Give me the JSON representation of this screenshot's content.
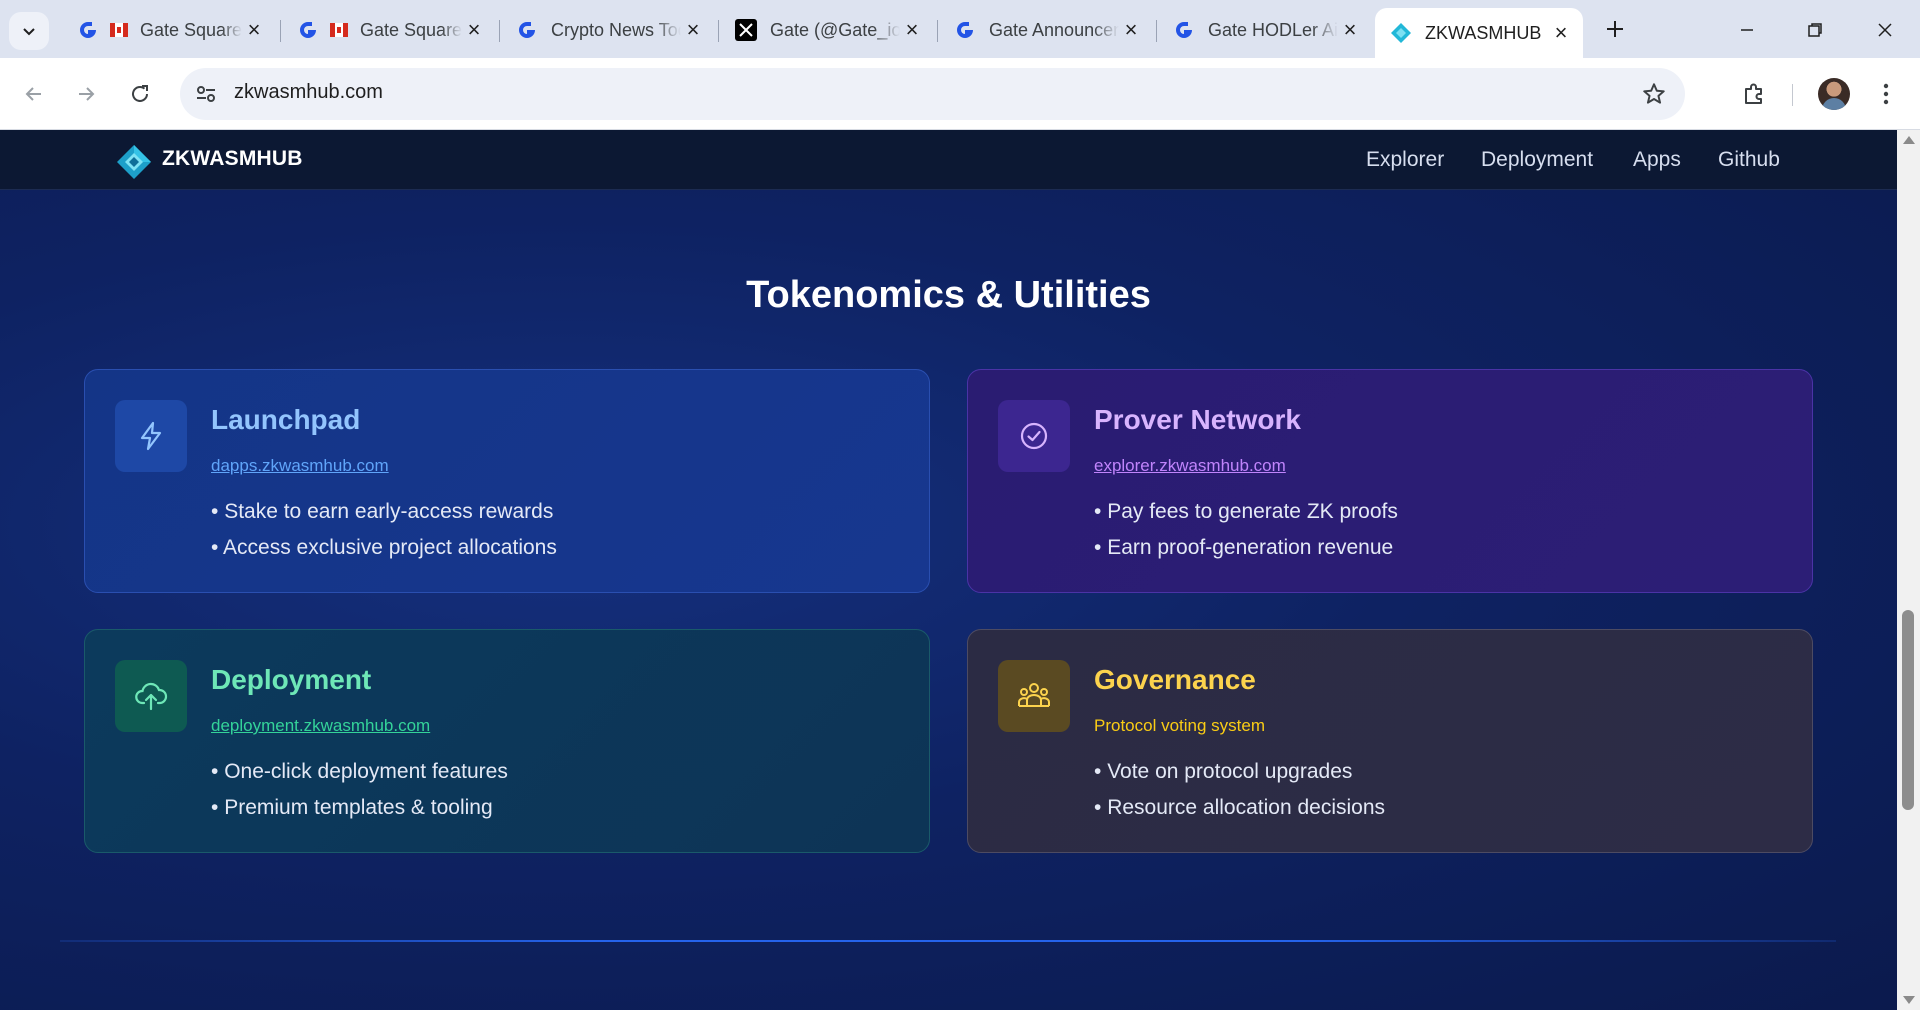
{
  "browser": {
    "tabs": [
      {
        "title": "Gate Square",
        "favicon": "gate-icon",
        "flag": true
      },
      {
        "title": "Gate Square",
        "favicon": "gate-icon",
        "flag": true
      },
      {
        "title": "Crypto News Today",
        "favicon": "gate-icon",
        "flag": false
      },
      {
        "title": "Gate (@Gate_io)",
        "favicon": "x-icon",
        "flag": false
      },
      {
        "title": "Gate Announcements",
        "favicon": "gate-icon",
        "flag": false
      },
      {
        "title": "Gate HODLer Airdrop",
        "favicon": "gate-icon",
        "flag": false
      }
    ],
    "active_tab": {
      "title": "ZKWASMHUB",
      "favicon": "zkwasmhub-logo-icon"
    },
    "url": "zkwasmhub.com"
  },
  "site": {
    "brand": "ZKWASMHUB",
    "nav": {
      "explorer": "Explorer",
      "deployment": "Deployment",
      "apps": "Apps",
      "github": "Github"
    },
    "section_title": "Tokenomics & Utilities",
    "cards": {
      "launchpad": {
        "title": "Launchpad",
        "link": "dapps.zkwasmhub.com",
        "icon": "lightning-icon",
        "bullets": [
          "Stake to earn early-access rewards",
          "Access exclusive project allocations"
        ]
      },
      "prover": {
        "title": "Prover Network",
        "link": "explorer.zkwasmhub.com",
        "icon": "check-circle-icon",
        "bullets": [
          "Pay fees to generate ZK proofs",
          "Earn proof-generation revenue"
        ]
      },
      "deployment": {
        "title": "Deployment",
        "link": "deployment.zkwasmhub.com",
        "icon": "cloud-upload-icon",
        "bullets": [
          "One-click deployment features",
          "Premium templates & tooling"
        ]
      },
      "governance": {
        "title": "Governance",
        "subtitle": "Protocol voting system",
        "icon": "people-group-icon",
        "bullets": [
          "Vote on protocol upgrades",
          "Resource allocation decisions"
        ]
      }
    }
  },
  "colors": {
    "page_bg": "#0e2262",
    "nav_bg": "#0c1833",
    "launchpad_accent": "#93c5fd",
    "prover_accent": "#d8b4fe",
    "deployment_accent": "#6ee7b7",
    "governance_accent": "#fcd34d"
  }
}
